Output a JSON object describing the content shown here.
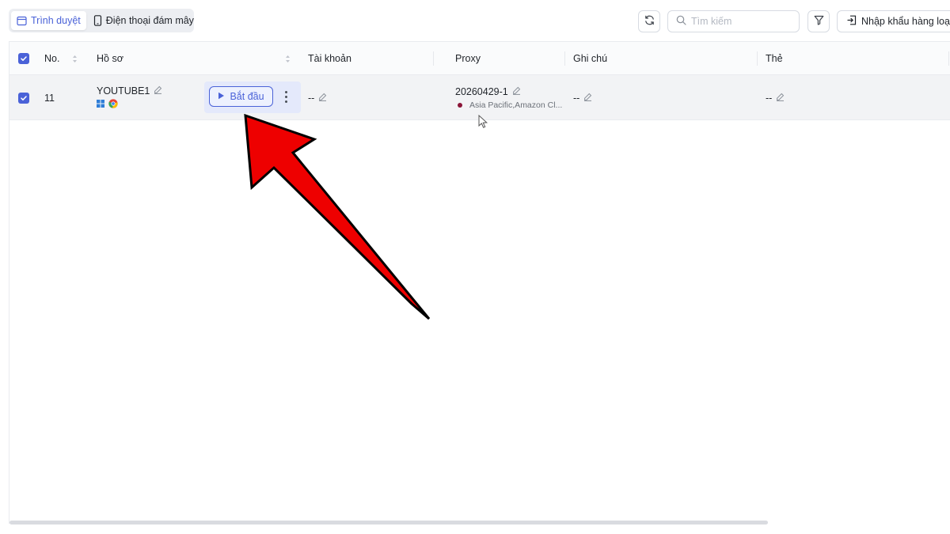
{
  "tabs": {
    "browser": "Trình duyệt",
    "cloud_phone": "Điện thoại đám mây"
  },
  "search": {
    "placeholder": "Tìm kiếm"
  },
  "toolbar": {
    "import_label": "Nhập khẩu hàng loạt"
  },
  "table": {
    "columns": {
      "no": "No.",
      "profile": "Hồ sơ",
      "account": "Tài khoản",
      "proxy": "Proxy",
      "note": "Ghi chú",
      "tag": "Thẻ"
    },
    "rows": [
      {
        "no": "11",
        "profile_name": "YOUTUBE1",
        "start_label": "Bắt đầu",
        "account": "--",
        "proxy_name": "20260429-1",
        "proxy_region": "Asia Pacific,Amazon Cl...",
        "note": "--",
        "tag": "--"
      }
    ]
  },
  "colors": {
    "accent": "#4a62d8",
    "row_selected_bg": "#f2f3f5",
    "proxy_dot": "#8b1538",
    "annotation_arrow": "#ee0000"
  },
  "icons": [
    "browser-window-icon",
    "phone-icon",
    "refresh-icon",
    "search-icon",
    "filter-icon",
    "import-icon",
    "sort-icon",
    "pencil-icon",
    "windows-icon",
    "chrome-icon",
    "play-icon",
    "more-vertical-icon"
  ]
}
